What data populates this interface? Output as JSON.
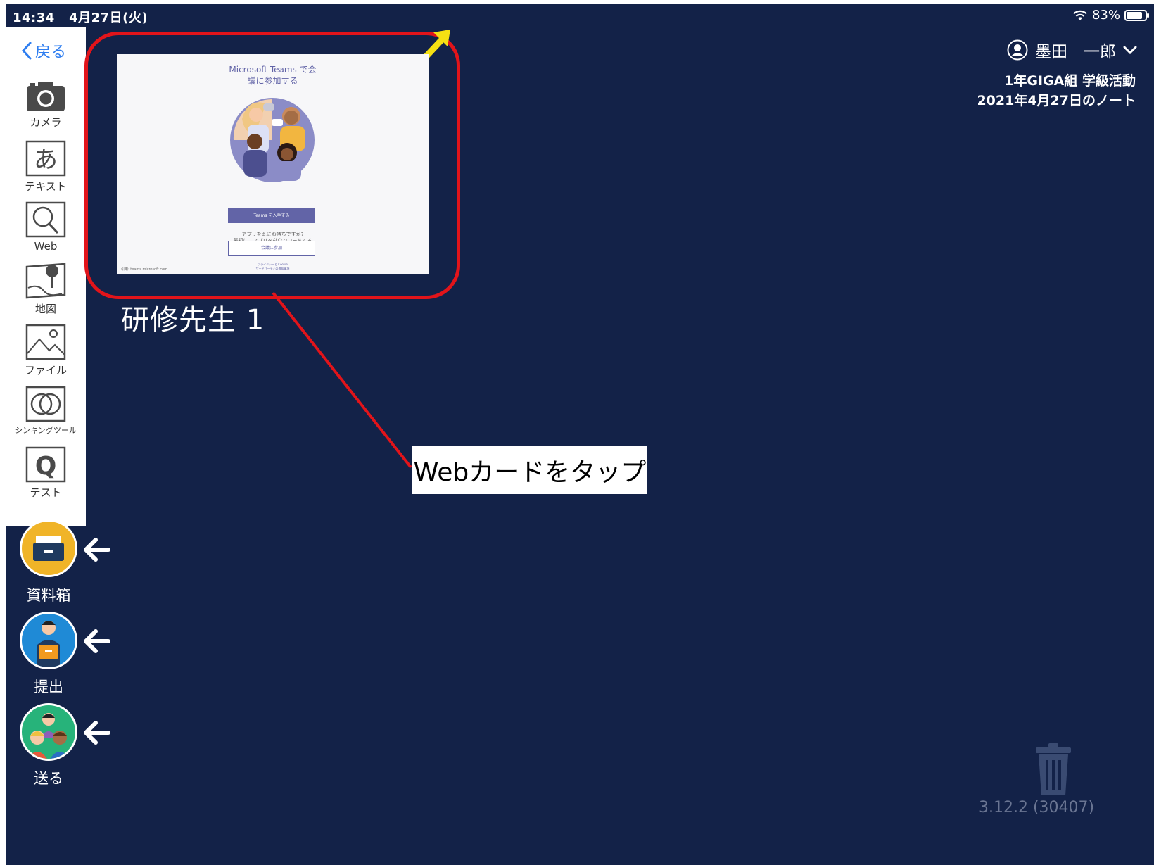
{
  "status_bar": {
    "time": "14:34",
    "date": "4月27日(火)",
    "battery": "83%",
    "battery_level": 0.83
  },
  "toolbar": {
    "back_label": "戻る",
    "tools": [
      {
        "label": "カメラ",
        "icon": "camera-icon"
      },
      {
        "label": "テキスト",
        "icon": "text-a-icon"
      },
      {
        "label": "Web",
        "icon": "magnifier-icon"
      },
      {
        "label": "地図",
        "icon": "map-pin-icon"
      },
      {
        "label": "ファイル",
        "icon": "image-file-icon"
      },
      {
        "label": "シンキングツール",
        "icon": "overlapping-circles-icon"
      },
      {
        "label": "テスト",
        "icon": "test-q-icon"
      }
    ]
  },
  "user": {
    "name": "墨田　一郎"
  },
  "note": {
    "class_name": "1年GIGA組 学級活動",
    "date": "2021年4月27日のノート"
  },
  "web_card": {
    "title_line1": "Microsoft Teams で会",
    "title_line2": "議に参加する",
    "description_line1": "最初に、アプリをダウンロードする",
    "description_line2": "必要があります。",
    "get_button": "Teams を入手する",
    "question": "アプリを既にお持ちですか?",
    "join_button": "会議に参加",
    "source": "引用: teams.microsoft.com",
    "footer_line1": "プライバシーと Cookie",
    "footer_line2": "サードパーティの通知事項",
    "caption": "研修先生 1"
  },
  "callout": {
    "text": "Webカードをタップ"
  },
  "actions": [
    {
      "label": "資料箱",
      "icon": "material-box-icon",
      "color": "#f0b428"
    },
    {
      "label": "提出",
      "icon": "submit-person-icon",
      "color": "#1f8ad6"
    },
    {
      "label": "送る",
      "icon": "send-group-icon",
      "color": "#27b37a"
    }
  ],
  "version": "3.12.2 (30407)",
  "colors": {
    "background": "#132248",
    "highlight": "#e2141a",
    "arrow": "#f5e013",
    "teams": "#6264a7",
    "back": "#2f7ef0"
  }
}
